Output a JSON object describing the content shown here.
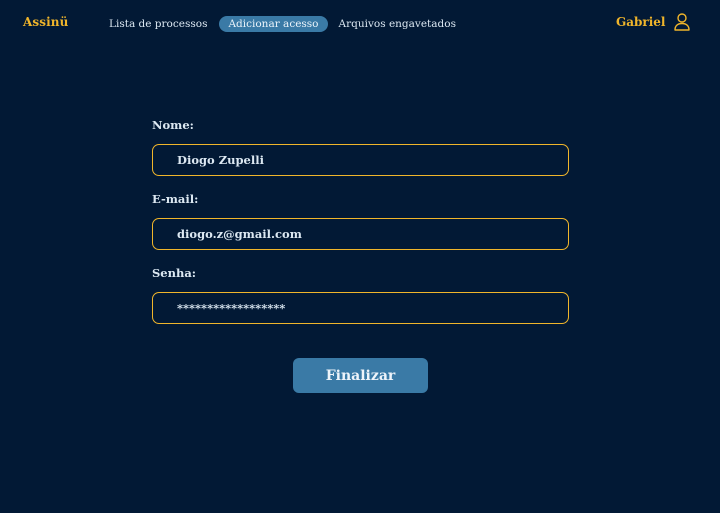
{
  "header": {
    "brand": "Assinü",
    "nav": [
      {
        "label": "Lista de processos",
        "active": false
      },
      {
        "label": "Adicionar acesso",
        "active": true
      },
      {
        "label": "Arquivos engavetados",
        "active": false
      }
    ],
    "user_name": "Gabriel",
    "user_icon": "user-icon"
  },
  "form": {
    "name_label": "Nome:",
    "name_value": "Diogo Zupelli",
    "email_label": "E-mail:",
    "email_value": "diogo.z@gmail.com",
    "password_label": "Senha:",
    "password_value": "******************",
    "submit_label": "Finalizar"
  },
  "colors": {
    "background": "#021935",
    "accent": "#F0B52B",
    "active_tab": "#3A7AA6",
    "text": "#DCE8F2"
  }
}
